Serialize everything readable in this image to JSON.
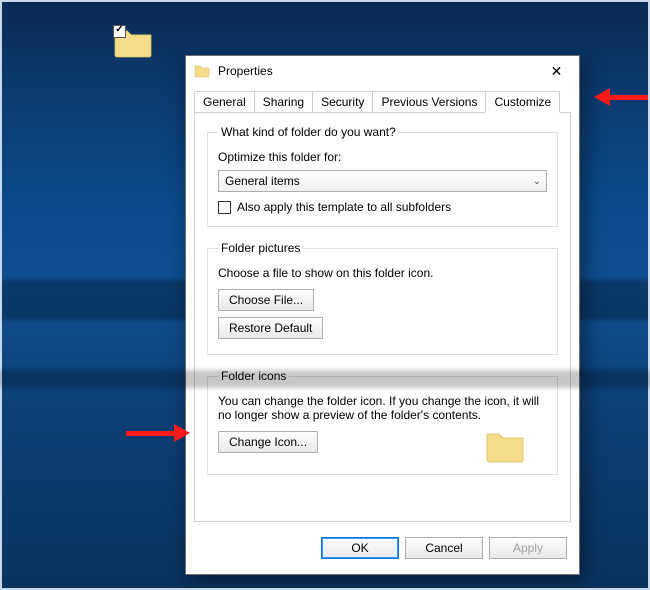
{
  "window": {
    "title": "Properties"
  },
  "tabs": {
    "general": "General",
    "sharing": "Sharing",
    "security": "Security",
    "previous": "Previous Versions",
    "customize": "Customize"
  },
  "group_kind": {
    "legend": "What kind of folder do you want?",
    "optimize_label": "Optimize this folder for:",
    "select_value": "General items",
    "also_apply_label": "Also apply this template to all subfolders"
  },
  "group_pictures": {
    "legend": "Folder pictures",
    "choose_desc": "Choose a file to show on this folder icon.",
    "choose_file": "Choose File...",
    "restore_default": "Restore Default"
  },
  "group_icons": {
    "legend": "Folder icons",
    "desc": "You can change the folder icon. If you change the icon, it will no longer show a preview of the folder's contents.",
    "change_icon": "Change Icon..."
  },
  "buttons": {
    "ok": "OK",
    "cancel": "Cancel",
    "apply": "Apply"
  }
}
